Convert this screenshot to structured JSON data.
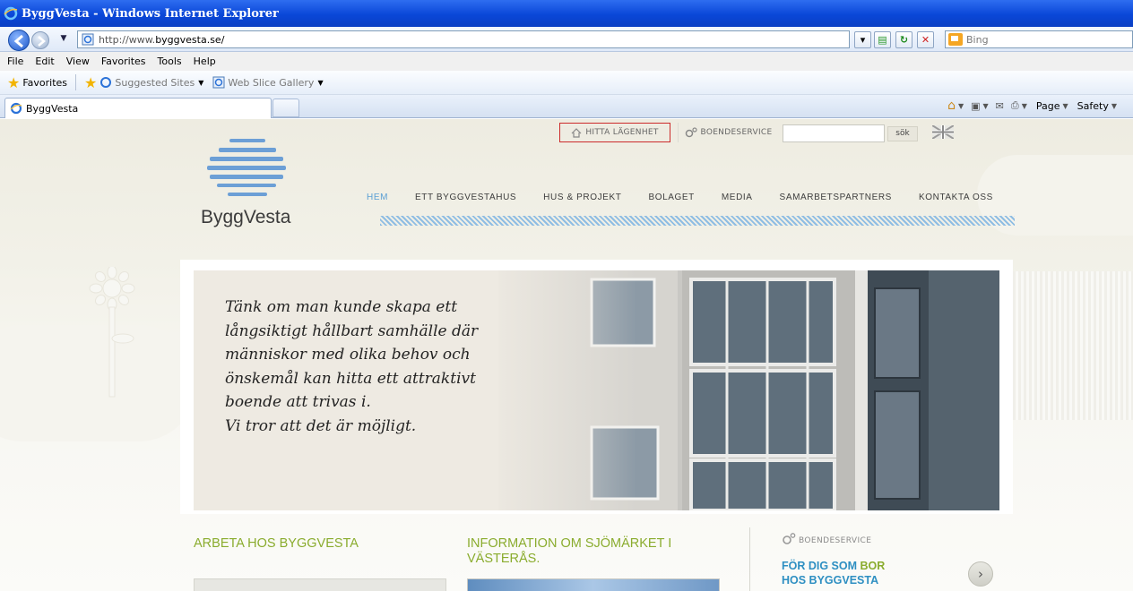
{
  "browser": {
    "window_title": "ByggVesta - Windows Internet Explorer",
    "address_prefix": "http://www.",
    "address_domain": "byggvesta.se/",
    "search_placeholder": "Bing",
    "menu": [
      "File",
      "Edit",
      "View",
      "Favorites",
      "Tools",
      "Help"
    ],
    "favorites_label": "Favorites",
    "favorites_links": [
      "Suggested Sites",
      "Web Slice Gallery"
    ],
    "tab_title": "ByggVesta",
    "command_page": "Page",
    "command_safety": "Safety"
  },
  "site": {
    "logo_text": "ByggVesta",
    "top_links": {
      "hitta": "HITTA LÄGENHET",
      "boende": "BOENDESERVICE",
      "search_button": "sök"
    },
    "nav": [
      "HEM",
      "ETT BYGGVESTAHUS",
      "HUS & PROJEKT",
      "BOLAGET",
      "MEDIA",
      "SAMARBETSPARTNERS",
      "KONTAKTA OSS"
    ],
    "nav_active_index": 0,
    "hero_quote": [
      "Tänk om man kunde skapa ett",
      "långsiktigt hållbart samhälle där",
      "människor med olika behov och",
      "önskemål kan hitta ett attraktivt",
      "boende att trivas i.",
      "Vi tror att det är möjligt."
    ],
    "columns": {
      "arbeta_title": "ARBETA HOS BYGGVESTA",
      "info_title": "INFORMATION OM SJÖMÄRKET I VÄSTERÅS.",
      "boendeservice_label": "BOENDESERVICE",
      "boendeservice_heading_1": "FÖR DIG SOM ",
      "boendeservice_heading_hl": "BOR",
      "boendeservice_heading_2": "HOS BYGGVESTA"
    }
  },
  "colors": {
    "ie_blue": "#0a47d8",
    "nav_active": "#5a9fd4",
    "accent_green": "#8aac2e",
    "accent_blue": "#2e8fc2",
    "hitta_border": "#cc2b2b"
  }
}
